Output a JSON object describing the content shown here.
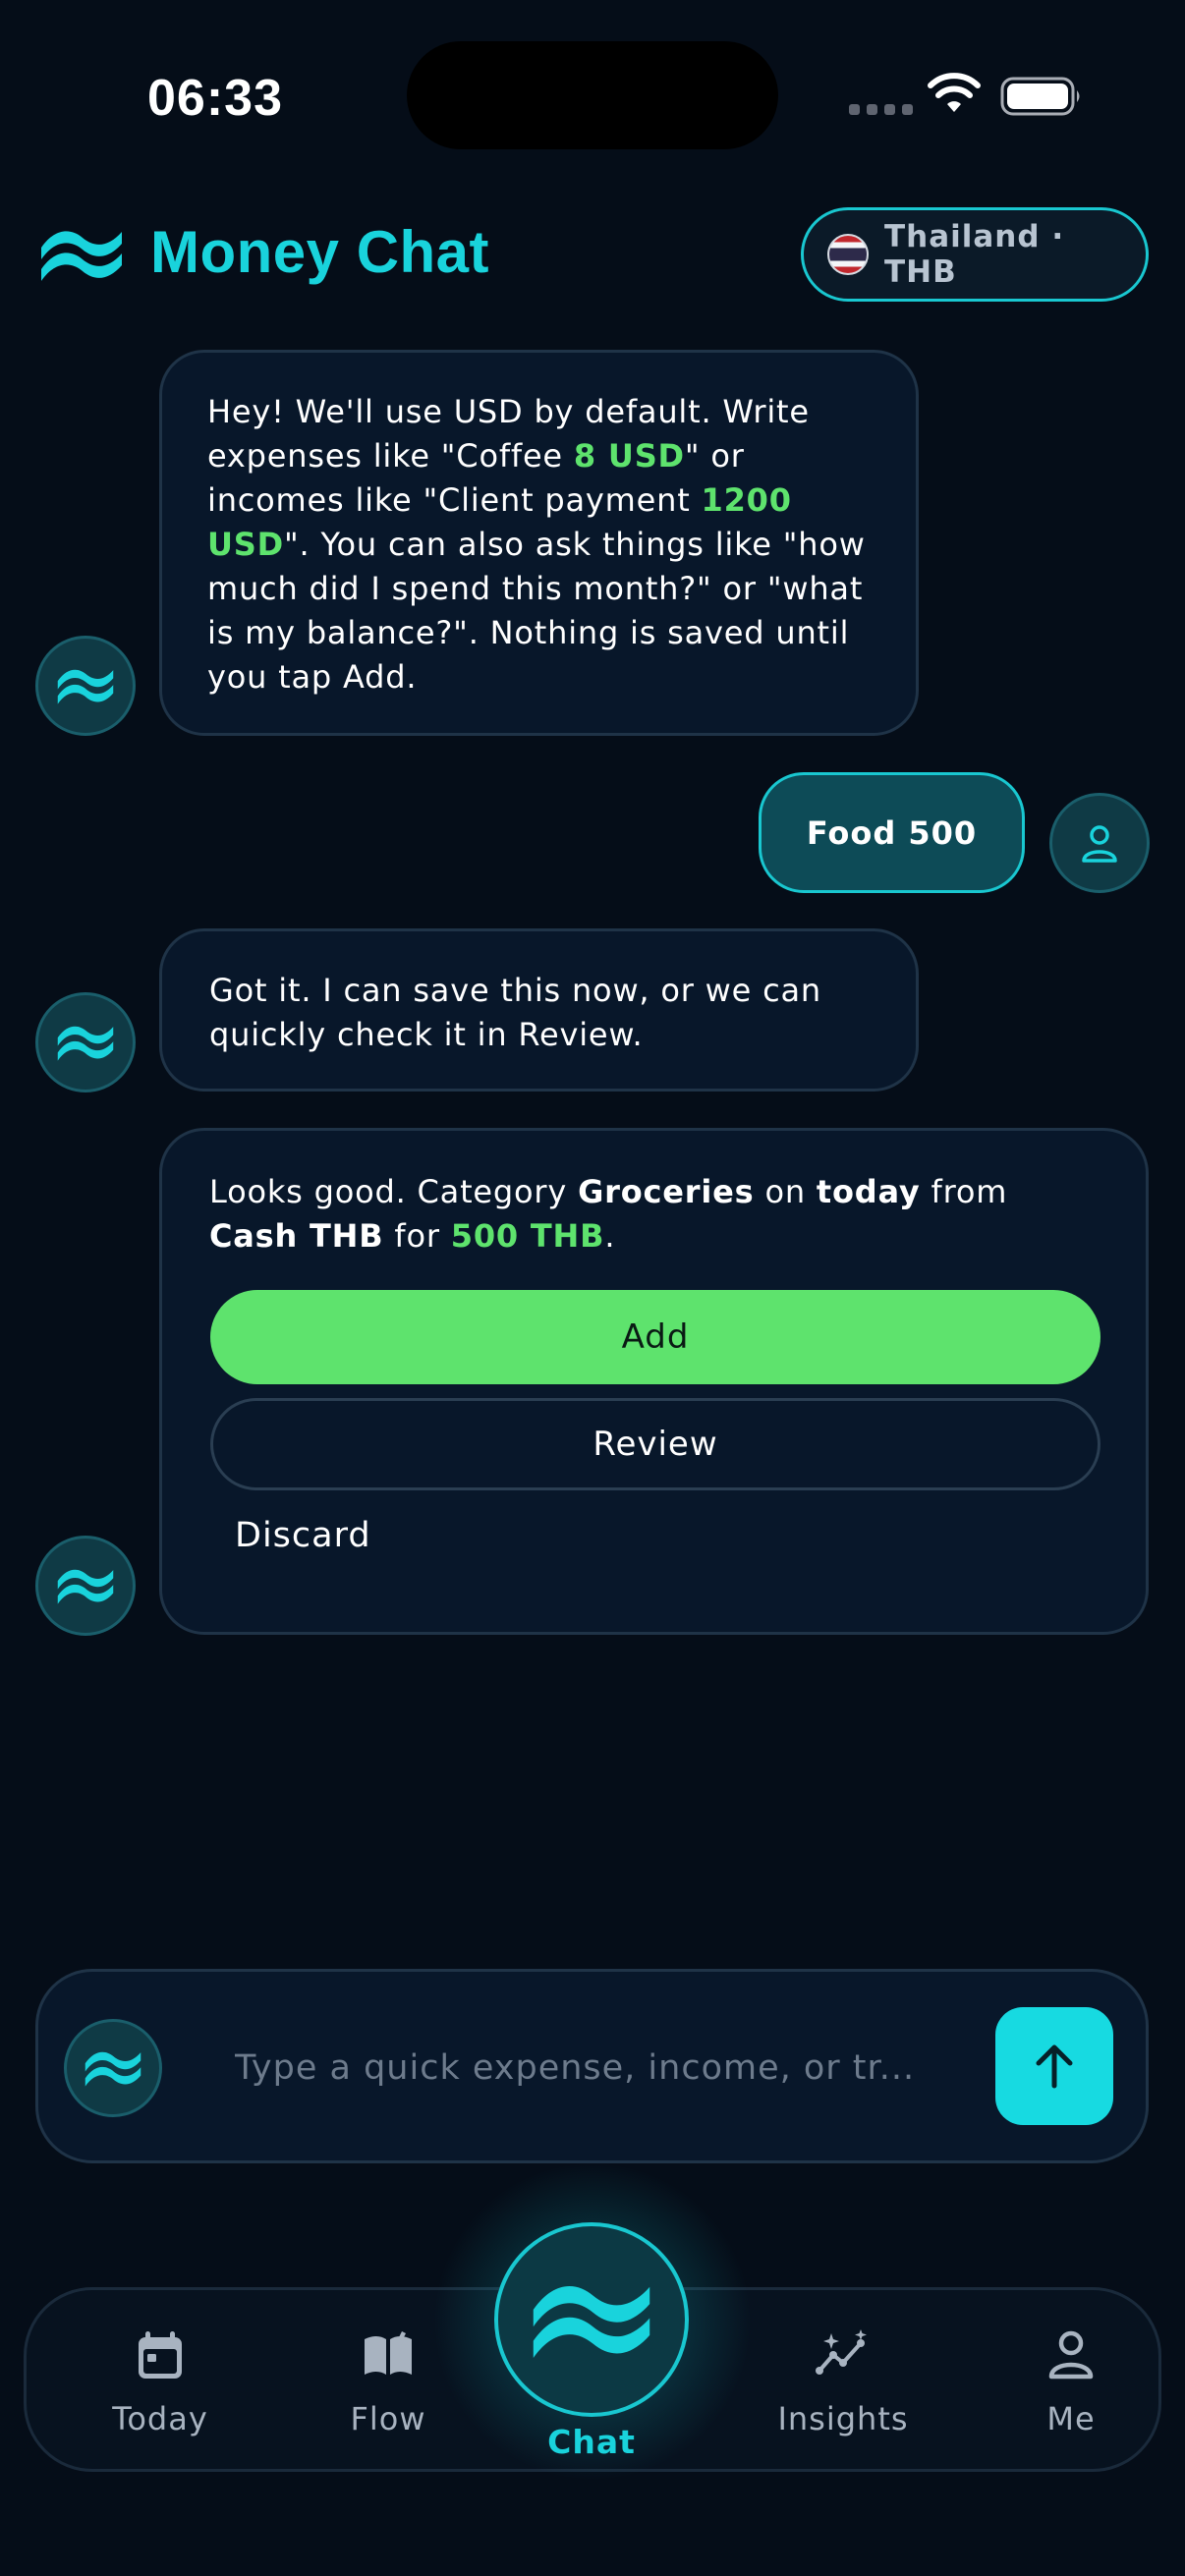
{
  "status_bar": {
    "time": "06:33"
  },
  "header": {
    "title": "Money Chat",
    "region": "Thailand · THB",
    "region_flag": "thailand-flag-icon"
  },
  "messages": {
    "welcome": {
      "p1": "Hey! We'll use USD by default. Write expenses like \"Coffee ",
      "h1": "8 USD",
      "p2": "\" or incomes like \"Client payment ",
      "h2": "1200 USD",
      "p3": "\". You can also ask things like \"how much did I spend this month?\" or \"what is my balance?\". Nothing is saved until you tap Add."
    },
    "user_message": "Food 500",
    "reply": "Got it. I can save this now, or we can quickly check it in Review.",
    "confirm": {
      "t1": "Looks good. Category ",
      "category": "Groceries",
      "t2": " on ",
      "date": "today",
      "t3": " from ",
      "account": "Cash THB",
      "t4": " for ",
      "amount": "500 THB",
      "t5": ".",
      "add_label": "Add",
      "review_label": "Review",
      "discard_label": "Discard"
    }
  },
  "composer": {
    "placeholder": "Type a quick expense, income, or tr..."
  },
  "tabs": {
    "today": "Today",
    "flow": "Flow",
    "chat": "Chat",
    "insights": "Insights",
    "me": "Me"
  },
  "colors": {
    "background": "#050d18",
    "accent": "#19d3dc",
    "positive": "#5ee36d",
    "bubble": "#08172a"
  }
}
